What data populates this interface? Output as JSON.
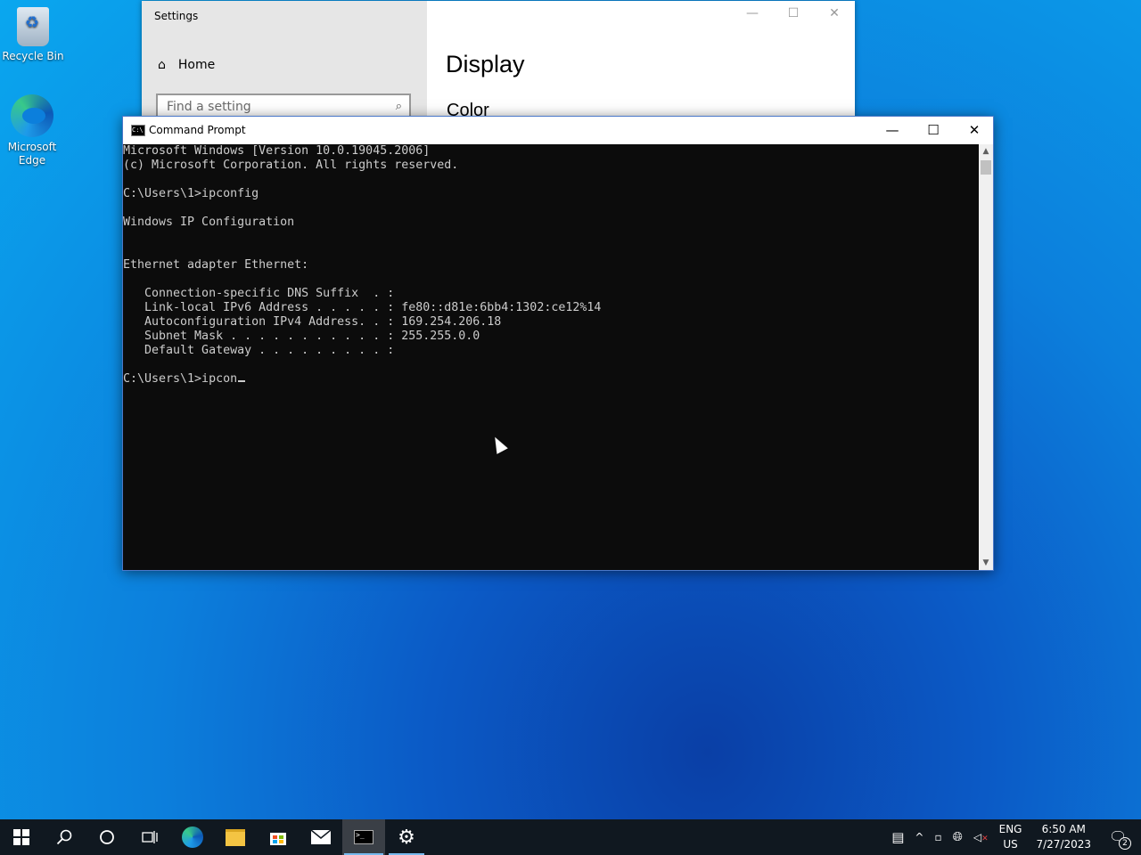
{
  "desktop": {
    "icons": [
      {
        "label": "Recycle Bin",
        "icon": "recycle-bin-icon"
      },
      {
        "label": "Microsoft Edge",
        "icon": "edge-icon"
      }
    ]
  },
  "settings": {
    "window_title": "Settings",
    "home_label": "Home",
    "search_placeholder": "Find a setting",
    "page_heading": "Display",
    "section_heading": "Color"
  },
  "cmd": {
    "title": "Command Prompt",
    "lines": [
      "Microsoft Windows [Version 10.0.19045.2006]",
      "(c) Microsoft Corporation. All rights reserved.",
      "",
      "C:\\Users\\1>ipconfig",
      "",
      "Windows IP Configuration",
      "",
      "",
      "Ethernet adapter Ethernet:",
      "",
      "   Connection-specific DNS Suffix  . :",
      "   Link-local IPv6 Address . . . . . : fe80::d81e:6bb4:1302:ce12%14",
      "   Autoconfiguration IPv4 Address. . : 169.254.206.18",
      "   Subnet Mask . . . . . . . . . . . : 255.255.0.0",
      "   Default Gateway . . . . . . . . . :",
      ""
    ],
    "prompt_line": "C:\\Users\\1>ipcon"
  },
  "taskbar": {
    "apps": [
      {
        "name": "start-button",
        "icon": "windows-logo-icon"
      },
      {
        "name": "search-button",
        "icon": "search-icon"
      },
      {
        "name": "cortana-button",
        "icon": "circle-icon"
      },
      {
        "name": "task-view-button",
        "icon": "task-view-icon"
      },
      {
        "name": "edge-taskbar-button",
        "icon": "edge-icon"
      },
      {
        "name": "file-explorer-button",
        "icon": "folder-icon"
      },
      {
        "name": "store-button",
        "icon": "store-icon"
      },
      {
        "name": "mail-button",
        "icon": "mail-icon"
      },
      {
        "name": "cmd-taskbar-button",
        "icon": "cmd-icon"
      },
      {
        "name": "settings-taskbar-button",
        "icon": "gear-icon"
      }
    ],
    "tray": {
      "language_top": "ENG",
      "language_bottom": "US",
      "time": "6:50 AM",
      "date": "7/27/2023",
      "notification_count": "2"
    }
  }
}
